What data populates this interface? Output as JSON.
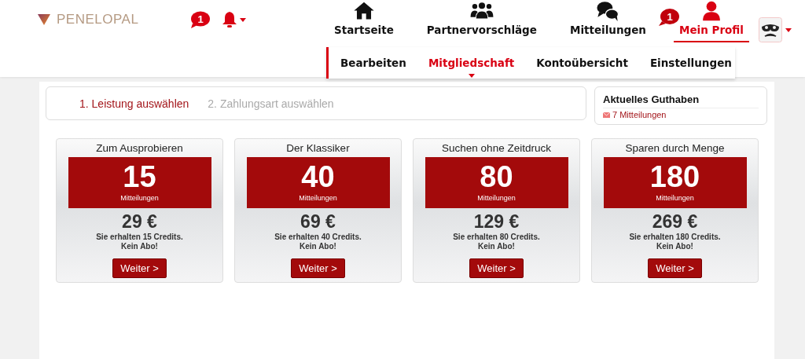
{
  "logo": {
    "text": "PENELOPAL"
  },
  "header_badges": {
    "messages_count": "1"
  },
  "nav": [
    {
      "label": "Startseite",
      "kind": "home",
      "selected": false
    },
    {
      "label": "Partnervorschläge",
      "kind": "people",
      "selected": false
    },
    {
      "label": "Mitteilungen",
      "kind": "chat",
      "selected": false,
      "badge": "1"
    },
    {
      "label": "Mein Profil",
      "kind": "user",
      "selected": true
    }
  ],
  "subnav": [
    {
      "label": "Bearbeiten",
      "selected": false
    },
    {
      "label": "Mitgliedschaft",
      "selected": true
    },
    {
      "label": "Kontoübersicht",
      "selected": false
    },
    {
      "label": "Einstellungen",
      "selected": false
    }
  ],
  "steps": [
    {
      "label": "1. Leistung auswählen",
      "selected": true
    },
    {
      "label": "2. Zahlungsart auswählen",
      "selected": false
    }
  ],
  "balance": {
    "title": "Aktuelles Guthaben",
    "messages": "7 Mitteilungen"
  },
  "packages": [
    {
      "title": "Zum Ausprobieren",
      "count": "15",
      "unit": "Mitteilungen",
      "price": "29 €",
      "note": "Sie erhalten 15 Credits.",
      "note2": "Kein Abo!",
      "button": "Weiter >"
    },
    {
      "title": "Der Klassiker",
      "count": "40",
      "unit": "Mitteilungen",
      "price": "69 €",
      "note": "Sie erhalten 40 Credits.",
      "note2": "Kein Abo!",
      "button": "Weiter >"
    },
    {
      "title": "Suchen ohne Zeitdruck",
      "count": "80",
      "unit": "Mitteilungen",
      "price": "129 €",
      "note": "Sie erhalten 80 Credits.",
      "note2": "Kein Abo!",
      "button": "Weiter >"
    },
    {
      "title": "Sparen durch Menge",
      "count": "180",
      "unit": "Mitteilungen",
      "price": "269 €",
      "note": "Sie erhalten 180 Credits.",
      "note2": "Kein Abo!",
      "button": "Weiter >"
    }
  ]
}
